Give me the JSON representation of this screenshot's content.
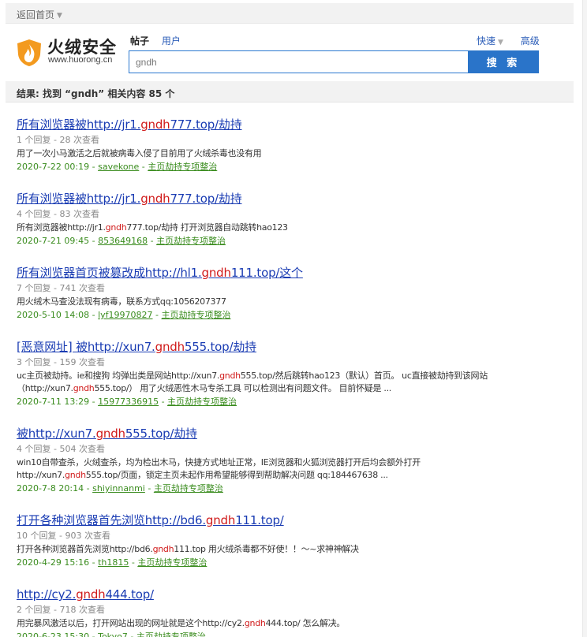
{
  "topbar": {
    "back_label": "返回首页"
  },
  "logo": {
    "name": "火绒安全",
    "url": "www.huorong.cn"
  },
  "tabs": [
    {
      "label": "帖子",
      "active": true
    },
    {
      "label": "用户",
      "active": false
    }
  ],
  "right_links": {
    "quick": "快速",
    "advanced": "高级"
  },
  "search": {
    "value": "gndh",
    "button_label": "搜 索"
  },
  "result_summary": "结果: 找到 “gndh” 相关内容 85 个",
  "colors": {
    "accent": "#2a74c9",
    "highlight": "#d01a1a",
    "meta_green": "#3a8c1e",
    "link": "#1a3cb3"
  },
  "results": [
    {
      "title_pre": "所有浏览器被http://jr1.",
      "title_hl": "gndh",
      "title_post": "777.top/劫持",
      "stats": "1 个回复 - 28 次查看",
      "summary": [
        {
          "pre": "用了一次小马激活之后就被病毒入侵了目前用了火绒杀毒也没有用",
          "hl": "",
          "post": ""
        }
      ],
      "date": "2020-7-22 00:19",
      "author": "savekone",
      "forum": "主页劫持专项整治"
    },
    {
      "title_pre": "所有浏览器被http://jr1.",
      "title_hl": "gndh",
      "title_post": "777.top/劫持",
      "stats": "4 个回复 - 83 次查看",
      "summary": [
        {
          "pre": "所有浏览器被http://jr1.",
          "hl": "gndh",
          "post": "777.top/劫持 打开浏览器自动跳转hao123"
        }
      ],
      "date": "2020-7-21 09:45",
      "author": "853649168",
      "forum": "主页劫持专项整治"
    },
    {
      "title_pre": "所有浏览器首页被篡改成http://hl1.",
      "title_hl": "gndh",
      "title_post": "111.top/这个",
      "stats": "7 个回复 - 741 次查看",
      "summary": [
        {
          "pre": "用火绒木马查没法现有病毒，联系方式qq:1056207377",
          "hl": "",
          "post": ""
        }
      ],
      "date": "2020-5-10 14:08",
      "author": "lyf19970827",
      "forum": "主页劫持专项整治"
    },
    {
      "title_pre": "[恶意网址] 被http://xun7.",
      "title_hl": "gndh",
      "title_post": "555.top/劫持",
      "stats": "3 个回复 - 159 次查看",
      "summary": [
        {
          "pre": "uc主页被劫持。ie和搜狗 均弹出类是网站http://xun7.",
          "hl": "gndh",
          "post": "555.top/然后跳转hao123（默认）首页。 uc直接被劫持到该网站"
        },
        {
          "pre": "（http://xun7.",
          "hl": "gndh",
          "post": "555.top/） 用了火绒恶性木马专杀工具 可以检测出有问题文件。 目前怀疑是 ..."
        }
      ],
      "date": "2020-7-11 13:29",
      "author": "15977336915",
      "forum": "主页劫持专项整治"
    },
    {
      "title_pre": "被http://xun7.",
      "title_hl": "gndh",
      "title_post": "555.top/劫持",
      "stats": "4 个回复 - 504 次查看",
      "summary": [
        {
          "pre": "win10自带查杀，火绒查杀，均为检出木马，快捷方式地址正常，IE浏览器和火狐浏览器打开后均会额外打开",
          "hl": "",
          "post": ""
        },
        {
          "pre": "http://xun7.",
          "hl": "gndh",
          "post": "555.top/页面，锁定主页未起作用希望能够得到帮助解决问题 qq:184467638 ..."
        }
      ],
      "date": "2020-7-8 20:14",
      "author": "shiyinnanmi",
      "forum": "主页劫持专项整治"
    },
    {
      "title_pre": "打开各种浏览器首先浏览http://bd6.",
      "title_hl": "gndh",
      "title_post": "111.top/",
      "stats": "10 个回复 - 903 次查看",
      "summary": [
        {
          "pre": "打开各种浏览器首先浏览http://bd6.",
          "hl": "gndh",
          "post": "111.top 用火绒杀毒都不好使！！～~求神神解决"
        }
      ],
      "date": "2020-4-29 15:16",
      "author": "th1815",
      "forum": "主页劫持专项整治"
    },
    {
      "title_pre": "http://cy2.",
      "title_hl": "gndh",
      "title_post": "444.top/",
      "stats": "2 个回复 - 718 次查看",
      "summary": [
        {
          "pre": "用完暴风激活以后，打开网站出现的网址就是这个http://cy2.",
          "hl": "gndh",
          "post": "444.top/ 怎么解决。"
        }
      ],
      "date": "2020-6-23 15:30",
      "author": "Tokyo7",
      "forum": "主页劫持专项整治"
    }
  ]
}
